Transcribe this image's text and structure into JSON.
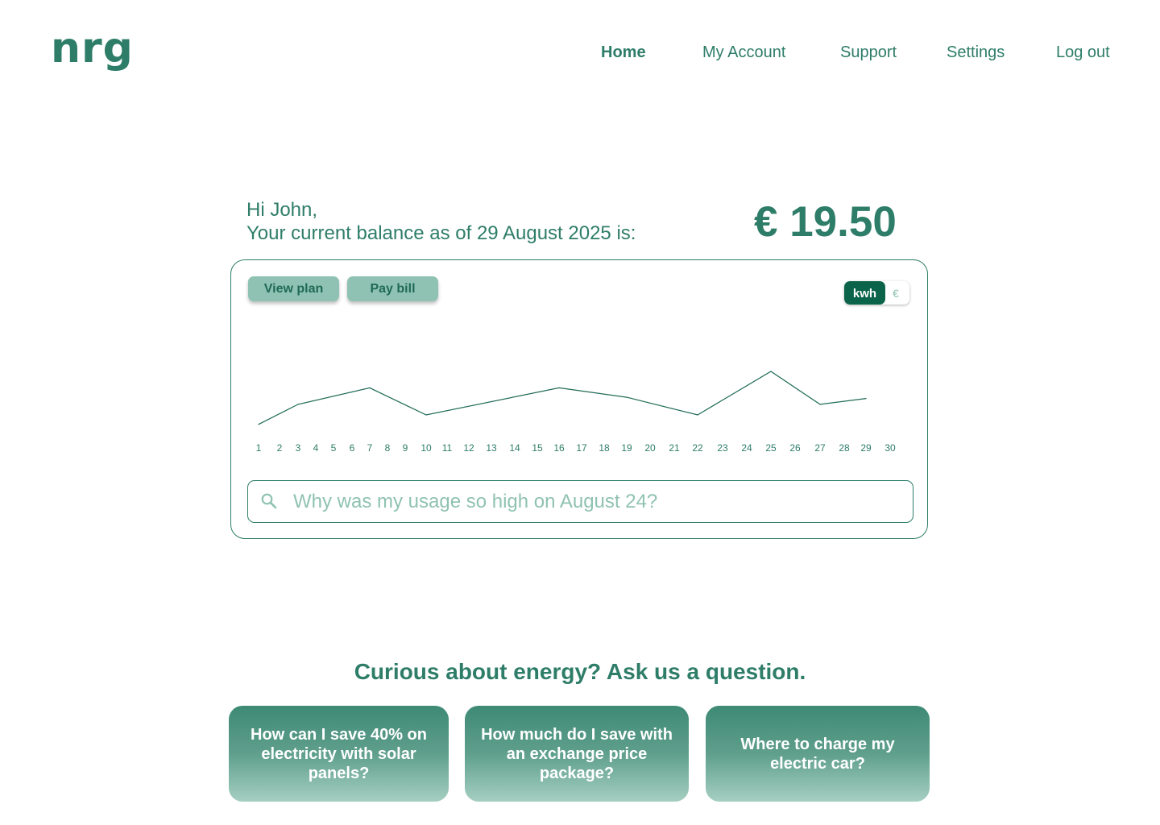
{
  "brand": {
    "logo": "nrg",
    "color": "#2e7d68"
  },
  "nav": {
    "items": [
      "Home",
      "My Account",
      "Support",
      "Settings",
      "Log out"
    ],
    "active": "Home"
  },
  "greeting": {
    "line1": "Hi John,",
    "line2": "Your current balance as of 29 August 2025 is:"
  },
  "balance": "€ 19.50",
  "card": {
    "buttons": {
      "view_plan": "View plan",
      "pay_bill": "Pay bill"
    },
    "unit_toggle": {
      "selected": "kwh",
      "other": "€"
    }
  },
  "chart_data": {
    "type": "line",
    "x": [
      1,
      3,
      7,
      10,
      16,
      19,
      22,
      25,
      27,
      29
    ],
    "y": [
      0.5,
      2.2,
      3.6,
      1.3,
      3.6,
      2.8,
      1.3,
      5.0,
      2.2,
      2.7
    ],
    "xticks": [
      "1",
      "2",
      "3",
      "4",
      "5",
      "6",
      "7",
      "8",
      "9",
      "10",
      "11",
      "12",
      "13",
      "14",
      "15",
      "16",
      "17",
      "18",
      "19",
      "20",
      "21",
      "22",
      "23",
      "24",
      "25",
      "26",
      "27",
      "28",
      "29",
      "30"
    ],
    "xlim": [
      1,
      30
    ],
    "grid": false
  },
  "search": {
    "placeholder": "Why was my usage so high on August 24?",
    "icon": "search-icon"
  },
  "ask": {
    "title": "Curious about energy? Ask us a question.",
    "questions": [
      "How can I save 40% on electricity with solar panels?",
      "How much do I save with an exchange price package?",
      "Where to charge my electric car?"
    ]
  }
}
